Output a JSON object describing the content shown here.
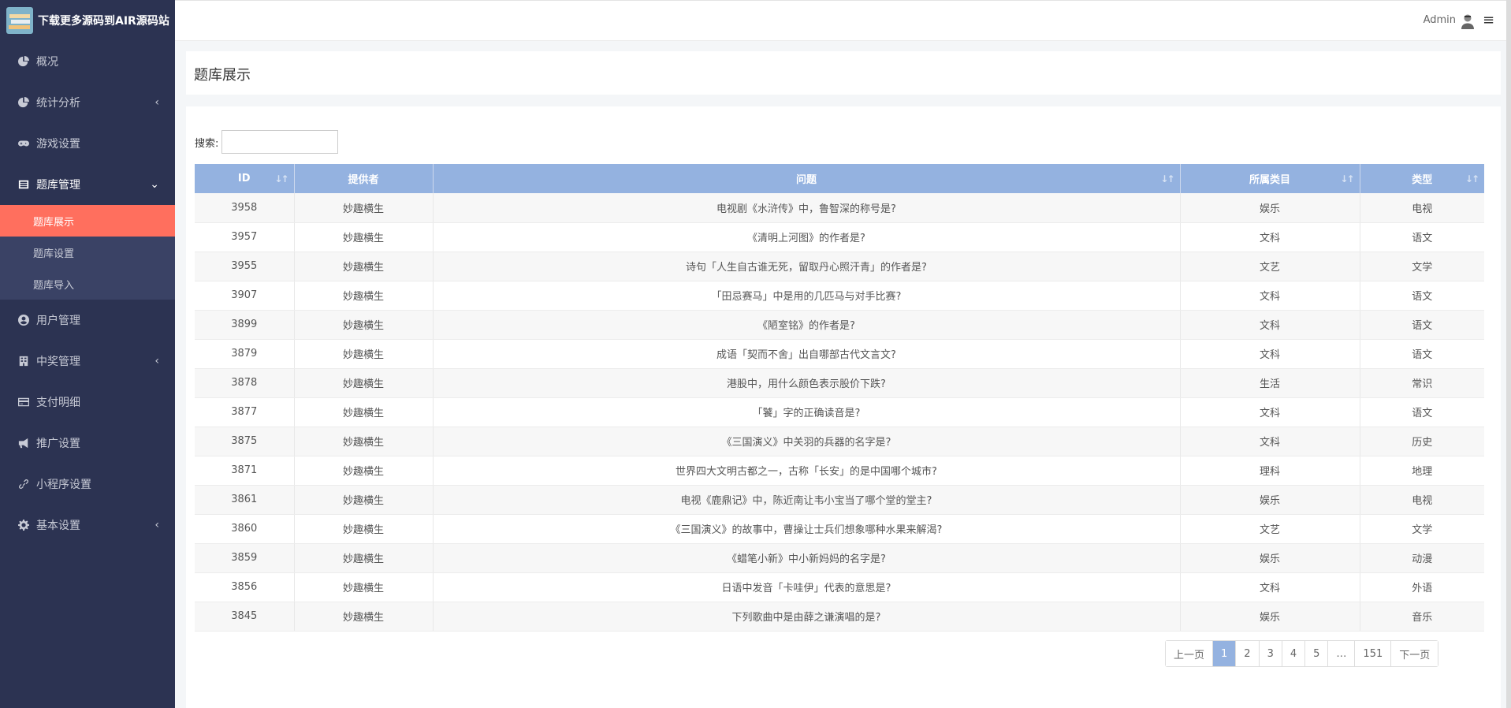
{
  "brand": {
    "title": "下载更多源码到AIR源码站"
  },
  "topbar": {
    "user": "Admin"
  },
  "sidebar": {
    "items": [
      {
        "label": "概况",
        "icon": "pie-chart-icon",
        "arrow": ""
      },
      {
        "label": "统计分析",
        "icon": "pie-chart-icon",
        "arrow": "‹"
      },
      {
        "label": "游戏设置",
        "icon": "gamepad-icon",
        "arrow": ""
      },
      {
        "label": "题库管理",
        "icon": "list-icon",
        "arrow": "⌄"
      },
      {
        "label": "用户管理",
        "icon": "user-circle-icon",
        "arrow": ""
      },
      {
        "label": "中奖管理",
        "icon": "building-icon",
        "arrow": "‹"
      },
      {
        "label": "支付明细",
        "icon": "credit-card-icon",
        "arrow": ""
      },
      {
        "label": "推广设置",
        "icon": "megaphone-icon",
        "arrow": ""
      },
      {
        "label": "小程序设置",
        "icon": "link-icon",
        "arrow": ""
      },
      {
        "label": "基本设置",
        "icon": "gear-icon",
        "arrow": "‹"
      }
    ],
    "submenu": [
      {
        "label": "题库展示",
        "active": true
      },
      {
        "label": "题库设置",
        "active": false
      },
      {
        "label": "题库导入",
        "active": false
      }
    ]
  },
  "page": {
    "title": "题库展示"
  },
  "search": {
    "label": "搜索:",
    "value": ""
  },
  "table": {
    "columns": [
      "ID",
      "提供者",
      "问题",
      "所属类目",
      "类型"
    ],
    "rows": [
      [
        "3958",
        "妙趣横生",
        "电视剧《水浒传》中，鲁智深的称号是?",
        "娱乐",
        "电视"
      ],
      [
        "3957",
        "妙趣横生",
        "《清明上河图》的作者是?",
        "文科",
        "语文"
      ],
      [
        "3955",
        "妙趣横生",
        "诗句「人生自古谁无死，留取丹心照汗青」的作者是?",
        "文艺",
        "文学"
      ],
      [
        "3907",
        "妙趣横生",
        "「田忌赛马」中是用的几匹马与对手比赛?",
        "文科",
        "语文"
      ],
      [
        "3899",
        "妙趣横生",
        "《陋室铭》的作者是?",
        "文科",
        "语文"
      ],
      [
        "3879",
        "妙趣横生",
        "成语「契而不舍」出自哪部古代文言文?",
        "文科",
        "语文"
      ],
      [
        "3878",
        "妙趣横生",
        "港股中，用什么颜色表示股价下跌?",
        "生活",
        "常识"
      ],
      [
        "3877",
        "妙趣横生",
        "「饕」字的正确读音是?",
        "文科",
        "语文"
      ],
      [
        "3875",
        "妙趣横生",
        "《三国演义》中关羽的兵器的名字是?",
        "文科",
        "历史"
      ],
      [
        "3871",
        "妙趣横生",
        "世界四大文明古都之一，古称「长安」的是中国哪个城市?",
        "理科",
        "地理"
      ],
      [
        "3861",
        "妙趣横生",
        "电视《鹿鼎记》中，陈近南让韦小宝当了哪个堂的堂主?",
        "娱乐",
        "电视"
      ],
      [
        "3860",
        "妙趣横生",
        "《三国演义》的故事中，曹操让士兵们想象哪种水果来解渴?",
        "文艺",
        "文学"
      ],
      [
        "3859",
        "妙趣横生",
        "《蜡笔小新》中小新妈妈的名字是?",
        "娱乐",
        "动漫"
      ],
      [
        "3856",
        "妙趣横生",
        "日语中发音「卡哇伊」代表的意思是?",
        "文科",
        "外语"
      ],
      [
        "3845",
        "妙趣横生",
        "下列歌曲中是由薛之谦演唱的是?",
        "娱乐",
        "音乐"
      ]
    ]
  },
  "pagination": {
    "prev": "上一页",
    "pages": [
      "1",
      "2",
      "3",
      "4",
      "5",
      "…",
      "151"
    ],
    "active": "1",
    "next": "下一页"
  },
  "colors": {
    "sidebar": "#2c3352",
    "submenu": "#3a4265",
    "active_item": "#ff6f5e",
    "table_header": "#94b2e0"
  }
}
